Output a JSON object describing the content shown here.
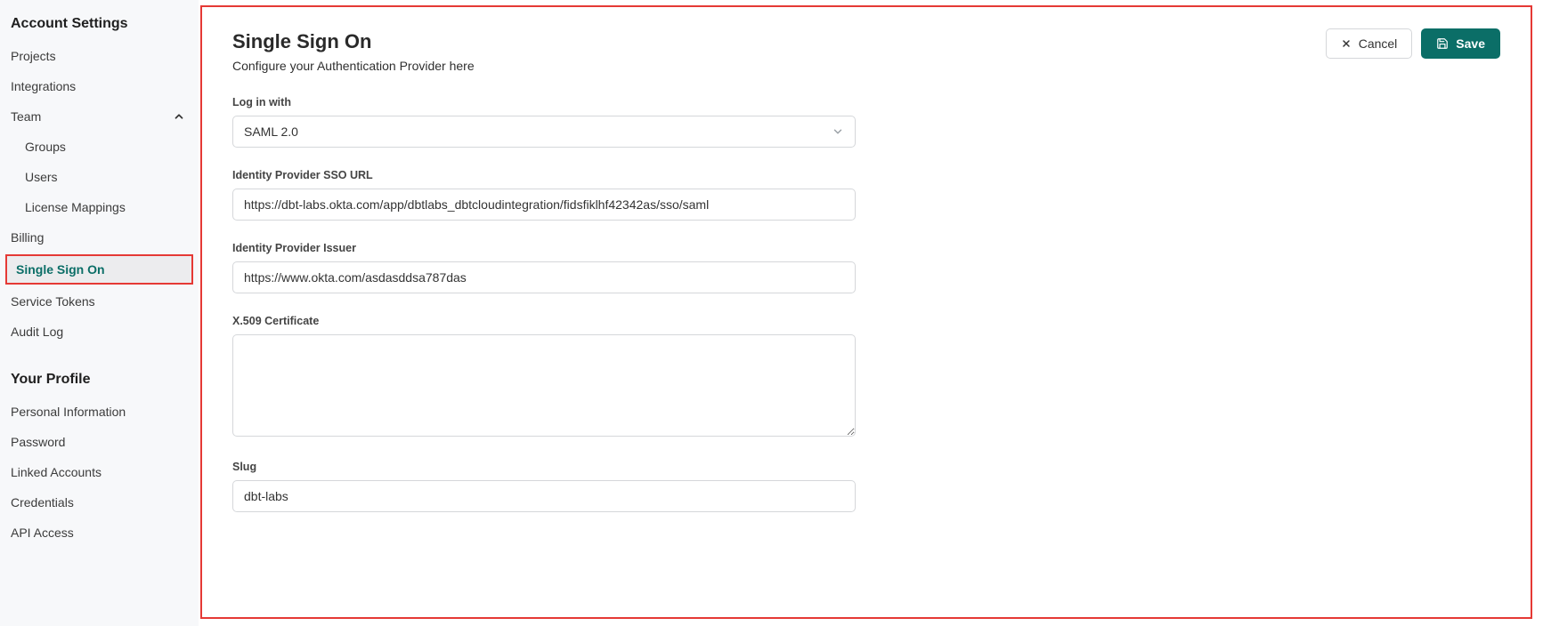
{
  "sidebar": {
    "account_section_title": "Account Settings",
    "items": {
      "projects": "Projects",
      "integrations": "Integrations",
      "team": "Team",
      "team_children": {
        "groups": "Groups",
        "users": "Users",
        "license_mappings": "License Mappings"
      },
      "billing": "Billing",
      "sso": "Single Sign On",
      "service_tokens": "Service Tokens",
      "audit_log": "Audit Log"
    },
    "profile_section_title": "Your Profile",
    "profile_items": {
      "personal_info": "Personal Information",
      "password": "Password",
      "linked_accounts": "Linked Accounts",
      "credentials": "Credentials",
      "api_access": "API Access"
    }
  },
  "header": {
    "title": "Single Sign On",
    "subtitle": "Configure your Authentication Provider here",
    "cancel_label": "Cancel",
    "save_label": "Save"
  },
  "form": {
    "login_with": {
      "label": "Log in with",
      "selected": "SAML 2.0"
    },
    "sso_url": {
      "label": "Identity Provider SSO URL",
      "value": "https://dbt-labs.okta.com/app/dbtlabs_dbtcloudintegration/fidsfiklhf42342as/sso/saml"
    },
    "issuer": {
      "label": "Identity Provider Issuer",
      "value": "https://www.okta.com/asdasddsa787das"
    },
    "cert": {
      "label": "X.509 Certificate",
      "value": ""
    },
    "slug": {
      "label": "Slug",
      "value": "dbt-labs"
    }
  }
}
